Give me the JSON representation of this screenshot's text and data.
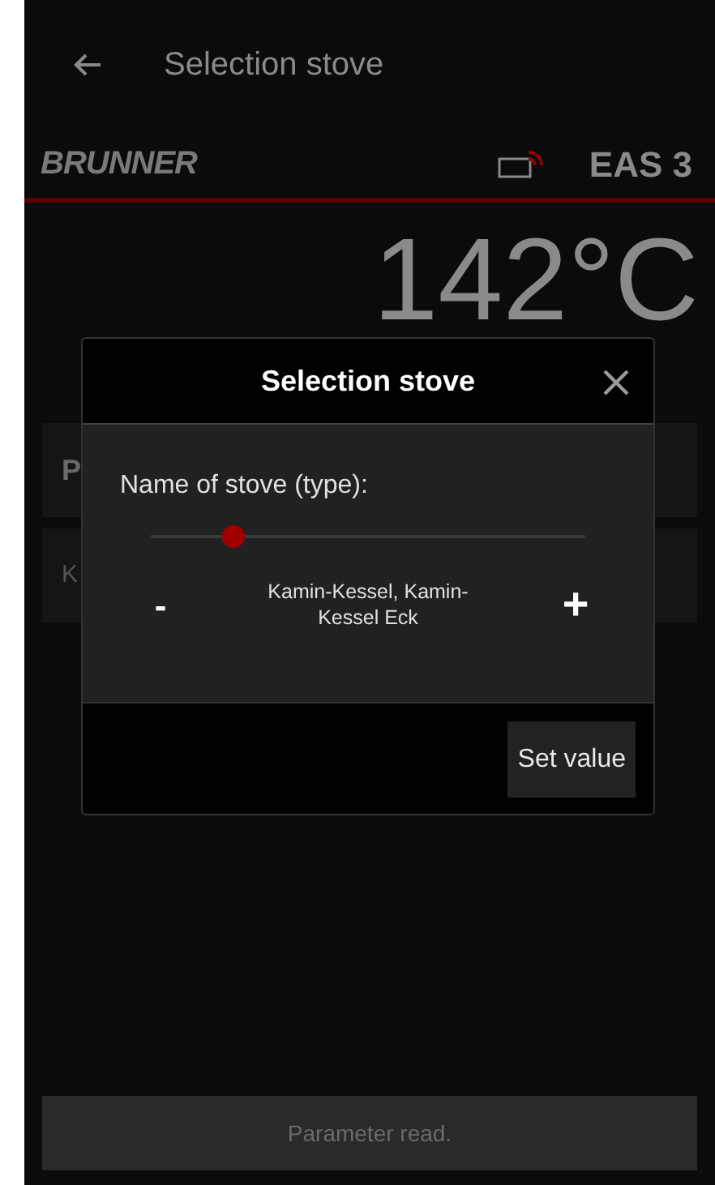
{
  "header": {
    "title": "Selection stove"
  },
  "brand_bar": {
    "logo": "BRUNNER",
    "device": "EAS 3"
  },
  "temperature": "142°C",
  "cards": [
    {
      "text": "P",
      "kind": "heading"
    },
    {
      "text": "K",
      "kind": "value"
    }
  ],
  "dialog": {
    "title": "Selection stove",
    "label": "Name of stove (type):",
    "slider": {
      "level": 0.19
    },
    "minus": "-",
    "plus": "+",
    "value": "Kamin-Kessel, Kamin-Kessel Eck",
    "button": "Set value"
  },
  "toast": "Parameter read."
}
